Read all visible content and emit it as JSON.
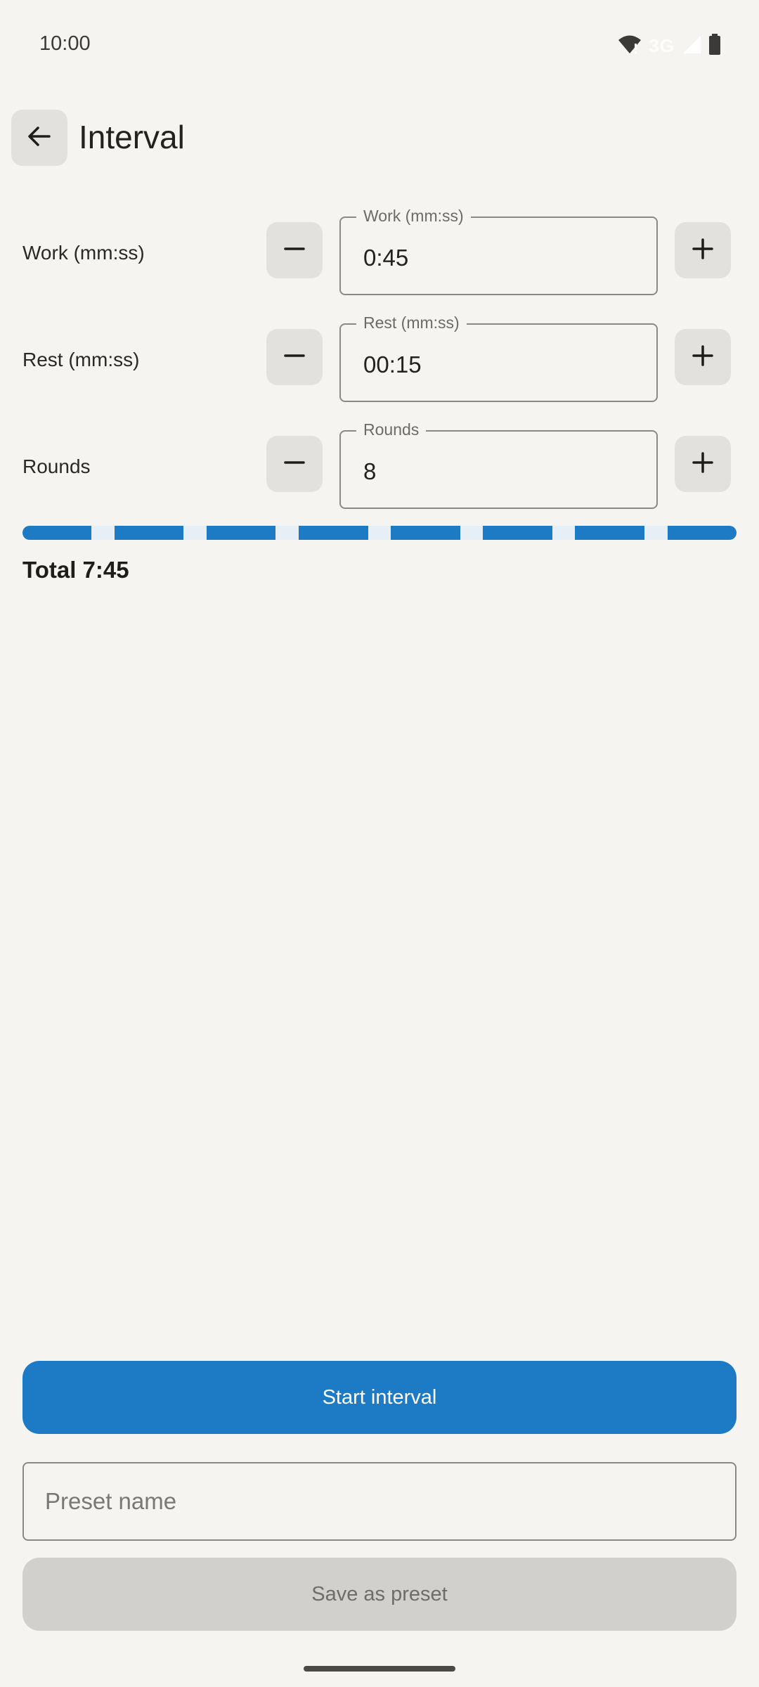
{
  "status_bar": {
    "time": "10:00",
    "network": "3G",
    "icons": [
      "wifi-alert-icon",
      "cellular-signal-icon",
      "battery-icon"
    ]
  },
  "header": {
    "back_icon": "arrow-back-icon",
    "title": "Interval"
  },
  "fields": {
    "work": {
      "label": "Work (mm:ss)",
      "legend": "Work (mm:ss)",
      "value": "0:45"
    },
    "rest": {
      "label": "Rest (mm:ss)",
      "legend": "Rest (mm:ss)",
      "value": "00:15"
    },
    "rounds": {
      "label": "Rounds",
      "legend": "Rounds",
      "value": "8"
    }
  },
  "timeline": {
    "rounds": 8,
    "work_seconds": 45,
    "rest_seconds": 15,
    "colors": {
      "work": "#1c7bc4",
      "rest": "#e6eff6"
    }
  },
  "summary": {
    "total": "Total 7:45"
  },
  "actions": {
    "start_label": "Start interval",
    "preset_placeholder": "Preset name",
    "save_label": "Save as preset"
  },
  "colors": {
    "accent": "#1c7bc4",
    "background": "#f5f4f1",
    "button_disabled": "#d1d0cd"
  }
}
